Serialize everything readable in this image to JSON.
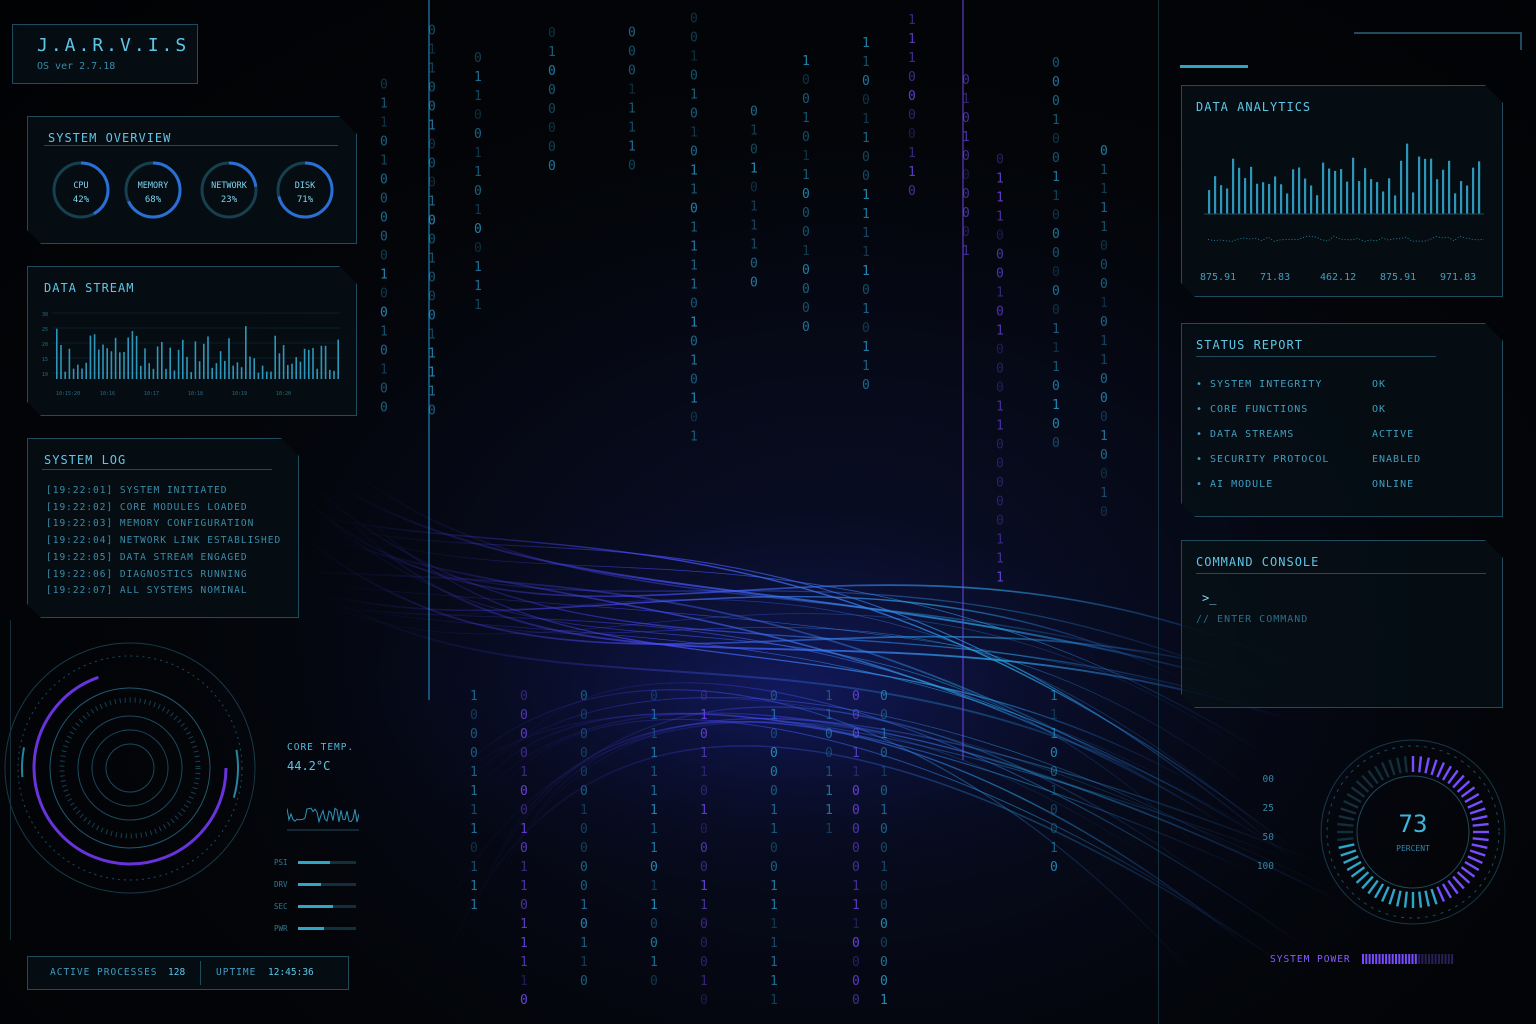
{
  "colors": {
    "accent": "#3fb6dc",
    "purple": "#8a5cff",
    "panel_border": "#1f4b5c",
    "bg": "#020408"
  },
  "header": {
    "title": "J.A.R.V.I.S",
    "version": "OS ver 2.7.18"
  },
  "system_overview": {
    "title": "SYSTEM OVERVIEW",
    "gauges": [
      {
        "label": "CPU",
        "value": "42%",
        "level": 0.42
      },
      {
        "label": "MEMORY",
        "value": "68%",
        "level": 0.68
      },
      {
        "label": "NETWORK",
        "value": "23%",
        "level": 0.23
      },
      {
        "label": "DISK",
        "value": "71%",
        "level": 0.71
      }
    ]
  },
  "data_stream": {
    "title": "DATA STREAM",
    "y_ticks": [
      "30",
      "25",
      "20",
      "15",
      "10"
    ],
    "x_ticks": [
      "10:15:20",
      "10:16",
      "10:17",
      "10:18",
      "10:19",
      "10:20"
    ]
  },
  "system_log": {
    "title": "SYSTEM LOG",
    "lines": [
      "[19:22:01] SYSTEM INITIATED",
      "[19:22:02] CORE MODULES LOADED",
      "[19:22:03] MEMORY CONFIGURATION",
      "[19:22:04] NETWORK LINK ESTABLISHED",
      "[19:22:05] DATA STREAM ENGAGED",
      "[19:22:06] DIAGNOSTICS RUNNING",
      "[19:22:07] ALL SYSTEMS NOMINAL"
    ]
  },
  "core": {
    "temp_label": "CORE TEMP.",
    "temp_value": "44.2°C",
    "bars": [
      {
        "label": "PSI",
        "level": 0.55
      },
      {
        "label": "DRV",
        "level": 0.4
      },
      {
        "label": "SEC",
        "level": 0.6
      },
      {
        "label": "PWR",
        "level": 0.45
      }
    ]
  },
  "footer": {
    "processes_label": "ACTIVE PROCESSES",
    "processes_value": "128",
    "uptime_label": "UPTIME",
    "uptime_value": "12:45:36"
  },
  "data_analytics": {
    "title": "DATA ANALYTICS",
    "values": [
      "875.91",
      "71.83",
      "462.12",
      "875.91",
      "971.83"
    ]
  },
  "status_report": {
    "title": "STATUS REPORT",
    "rows": [
      {
        "name": "• SYSTEM INTEGRITY",
        "status": "OK"
      },
      {
        "name": "• CORE FUNCTIONS",
        "status": "OK"
      },
      {
        "name": "• DATA STREAMS",
        "status": "ACTIVE"
      },
      {
        "name": "• SECURITY PROTOCOL",
        "status": "ENABLED"
      },
      {
        "name": "• AI MODULE",
        "status": "ONLINE"
      }
    ]
  },
  "command_console": {
    "title": "COMMAND CONSOLE",
    "prompt": ">_",
    "placeholder": "// ENTER COMMAND"
  },
  "power_gauge": {
    "value": "73",
    "unit": "PERCENT",
    "level": 0.73,
    "scale": [
      "00",
      "25",
      "50",
      "100"
    ]
  },
  "system_power": {
    "label": "SYSTEM POWER",
    "level": 0.62
  }
}
